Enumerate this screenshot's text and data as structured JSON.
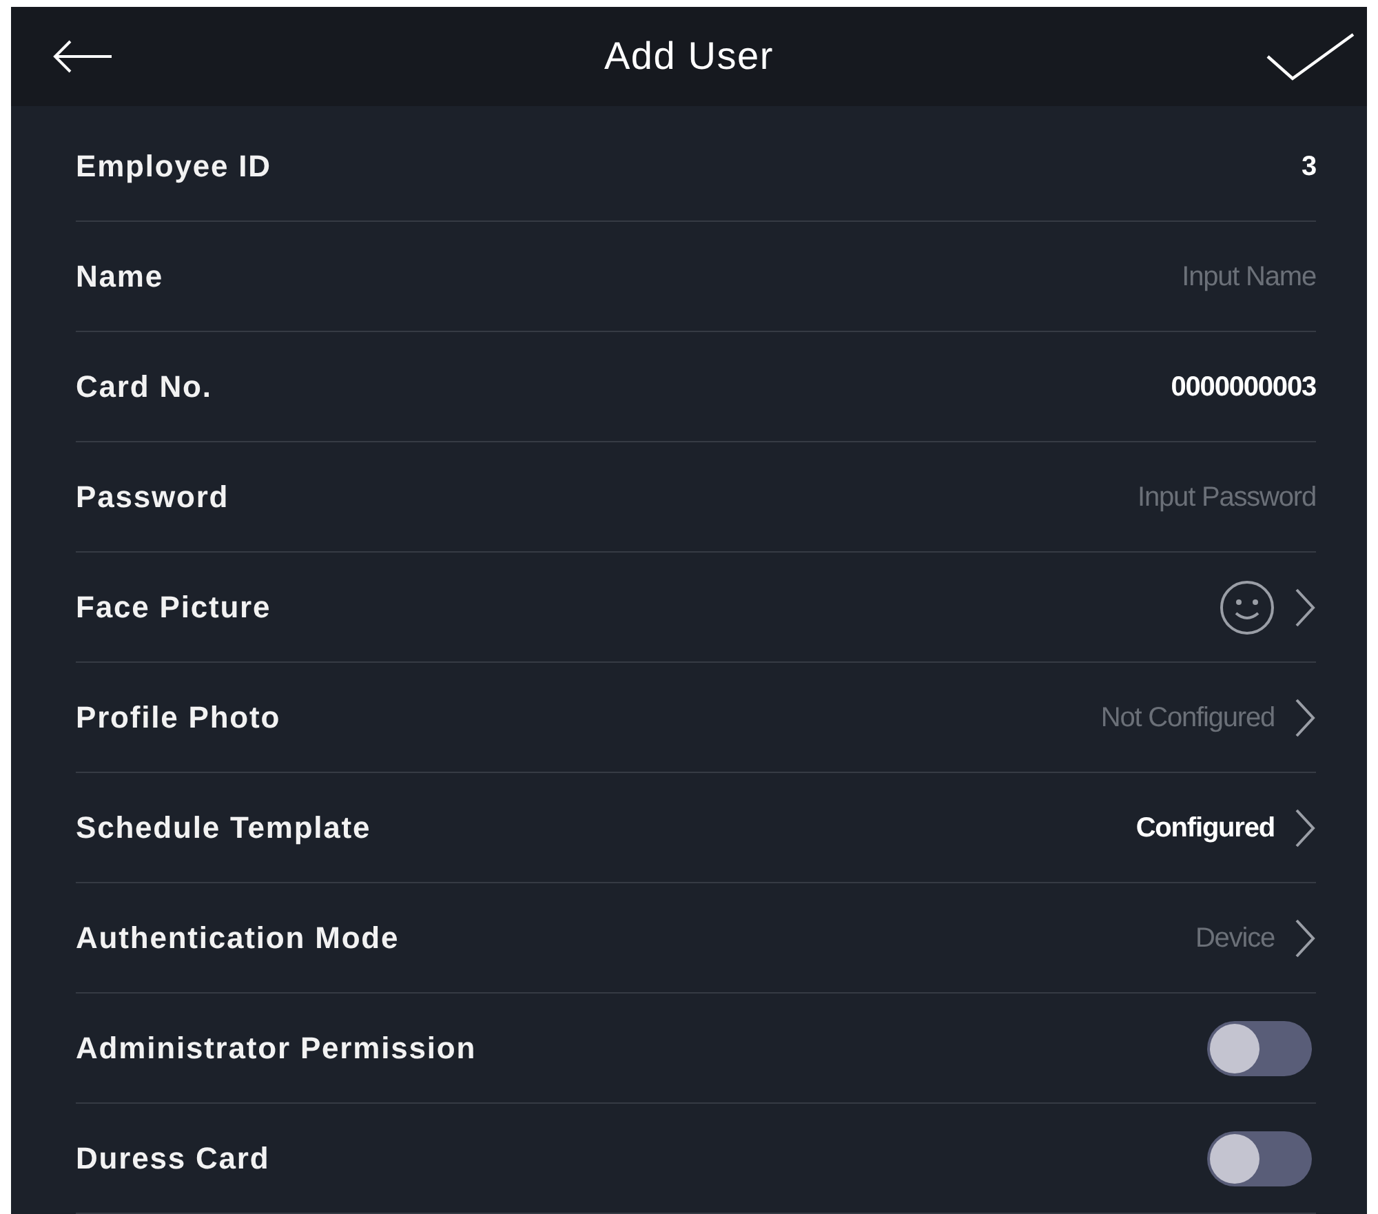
{
  "header": {
    "title": "Add User"
  },
  "rows": [
    {
      "kind": "input",
      "label": "Employee ID",
      "value": "3"
    },
    {
      "kind": "input",
      "label": "Name",
      "placeholder": "Input Name"
    },
    {
      "kind": "input",
      "label": "Card No.",
      "value": "0000000003"
    },
    {
      "kind": "input",
      "label": "Password",
      "placeholder": "Input Password"
    },
    {
      "kind": "face",
      "label": "Face Picture"
    },
    {
      "kind": "link",
      "label": "Profile Photo",
      "value": "Not Configured",
      "muted": true
    },
    {
      "kind": "link",
      "label": "Schedule Template",
      "value": "Configured",
      "muted": false
    },
    {
      "kind": "link",
      "label": "Authentication Mode",
      "value": "Device",
      "muted": true
    },
    {
      "kind": "toggle",
      "label": "Administrator Permission",
      "on": false
    },
    {
      "kind": "toggle",
      "label": "Duress Card",
      "on": false
    }
  ]
}
